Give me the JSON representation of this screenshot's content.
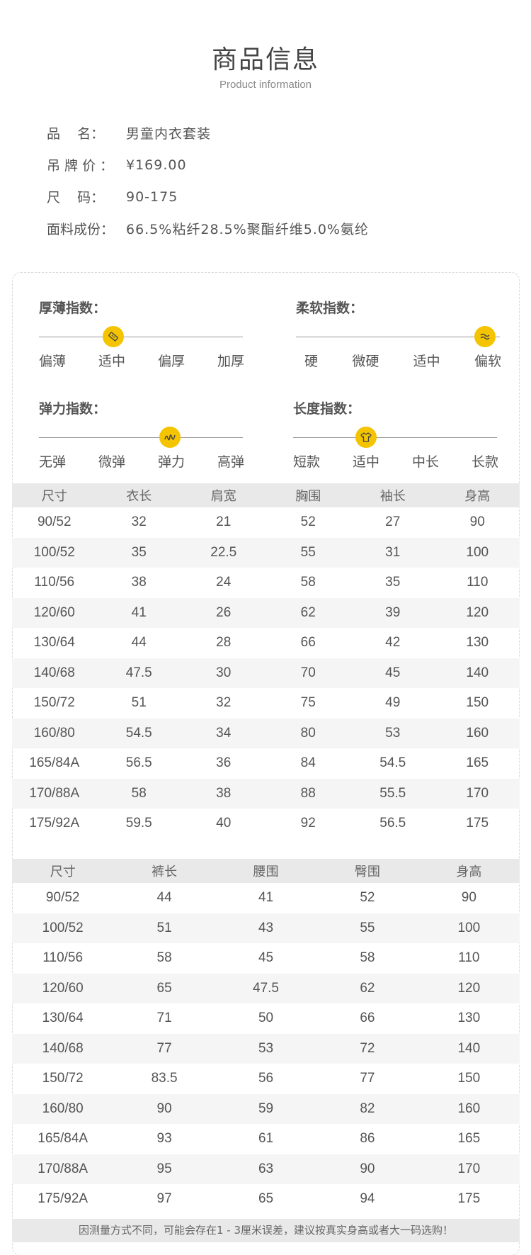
{
  "header": {
    "title": "商品信息",
    "subtitle": "Product information"
  },
  "info": [
    {
      "label": "品    名：",
      "value": "男童内衣套装"
    },
    {
      "label": "吊 牌 价 ：",
      "value": "¥169.00"
    },
    {
      "label": "尺    码：",
      "value": "90-175"
    },
    {
      "label": "面料成份：",
      "value": "66.5%粘纤28.5%聚酯纤维5.0%氨纶"
    }
  ],
  "indices": [
    {
      "title": "厚薄指数：",
      "labels": [
        "偏薄",
        "适中",
        "偏厚",
        "加厚"
      ],
      "selected": "适中",
      "icon": "ruler-icon"
    },
    {
      "title": "柔软指数：",
      "labels": [
        "硬",
        "微硬",
        "适中",
        "偏软"
      ],
      "selected": "偏软",
      "icon": "wave-icon"
    },
    {
      "title": "弹力指数：",
      "labels": [
        "无弹",
        "微弹",
        "弹力",
        "高弹"
      ],
      "selected": "弹力",
      "icon": "spring-icon"
    },
    {
      "title": "长度指数：",
      "labels": [
        "短款",
        "适中",
        "中长",
        "长款"
      ],
      "selected": "适中",
      "icon": "shirt-icon"
    }
  ],
  "top_table": {
    "headers": [
      "尺寸",
      "衣长",
      "肩宽",
      "胸围",
      "袖长",
      "身高"
    ],
    "rows": [
      [
        "90/52",
        "32",
        "21",
        "52",
        "27",
        "90"
      ],
      [
        "100/52",
        "35",
        "22.5",
        "55",
        "31",
        "100"
      ],
      [
        "110/56",
        "38",
        "24",
        "58",
        "35",
        "110"
      ],
      [
        "120/60",
        "41",
        "26",
        "62",
        "39",
        "120"
      ],
      [
        "130/64",
        "44",
        "28",
        "66",
        "42",
        "130"
      ],
      [
        "140/68",
        "47.5",
        "30",
        "70",
        "45",
        "140"
      ],
      [
        "150/72",
        "51",
        "32",
        "75",
        "49",
        "150"
      ],
      [
        "160/80",
        "54.5",
        "34",
        "80",
        "53",
        "160"
      ],
      [
        "165/84A",
        "56.5",
        "36",
        "84",
        "54.5",
        "165"
      ],
      [
        "170/88A",
        "58",
        "38",
        "88",
        "55.5",
        "170"
      ],
      [
        "175/92A",
        "59.5",
        "40",
        "92",
        "56.5",
        "175"
      ]
    ]
  },
  "bottom_table": {
    "headers": [
      "尺寸",
      "裤长",
      "腰围",
      "臀围",
      "身高"
    ],
    "rows": [
      [
        "90/52",
        "44",
        "41",
        "52",
        "90"
      ],
      [
        "100/52",
        "51",
        "43",
        "55",
        "100"
      ],
      [
        "110/56",
        "58",
        "45",
        "58",
        "110"
      ],
      [
        "120/60",
        "65",
        "47.5",
        "62",
        "120"
      ],
      [
        "130/64",
        "71",
        "50",
        "66",
        "130"
      ],
      [
        "140/68",
        "77",
        "53",
        "72",
        "140"
      ],
      [
        "150/72",
        "83.5",
        "56",
        "77",
        "150"
      ],
      [
        "160/80",
        "90",
        "59",
        "82",
        "160"
      ],
      [
        "165/84A",
        "93",
        "61",
        "86",
        "165"
      ],
      [
        "170/88A",
        "95",
        "63",
        "90",
        "170"
      ],
      [
        "175/92A",
        "97",
        "65",
        "94",
        "175"
      ]
    ]
  },
  "note": "因测量方式不同，可能会存在1 - 3厘米误差，建议按真实身高或者大一码选购！",
  "colors": {
    "accent": "#f5c400",
    "header_bg": "#e9e9e9",
    "alt_row_bg": "#f5f5f5"
  }
}
